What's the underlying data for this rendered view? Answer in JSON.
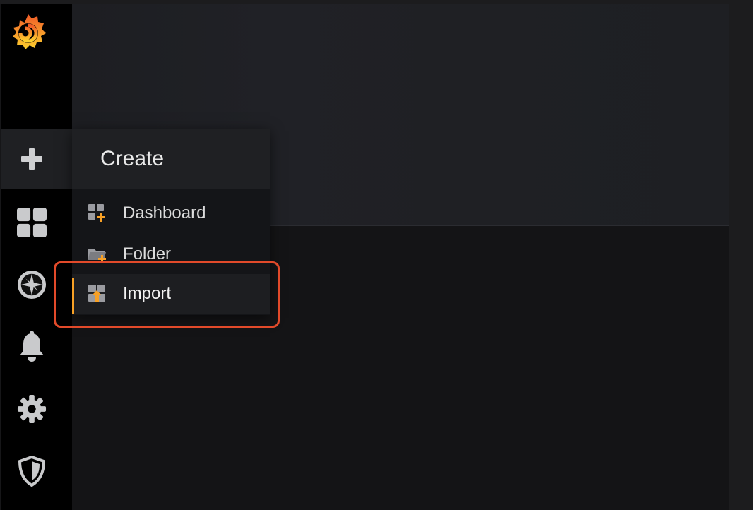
{
  "colors": {
    "accent": "#f8a126",
    "highlight": "#e24a2a",
    "sidebar_bg": "#000000"
  },
  "sidebar": {
    "items": [
      {
        "name": "create",
        "icon": "plus-icon"
      },
      {
        "name": "dashboards",
        "icon": "grid-icon"
      },
      {
        "name": "explore",
        "icon": "compass-icon"
      },
      {
        "name": "alerting",
        "icon": "bell-icon"
      },
      {
        "name": "configuration",
        "icon": "gear-icon"
      },
      {
        "name": "server-admin",
        "icon": "shield-icon"
      }
    ]
  },
  "create_menu": {
    "title": "Create",
    "items": [
      {
        "label": "Dashboard",
        "icon": "dashboard-add-icon"
      },
      {
        "label": "Folder",
        "icon": "folder-add-icon"
      },
      {
        "label": "Import",
        "icon": "import-icon"
      }
    ]
  }
}
